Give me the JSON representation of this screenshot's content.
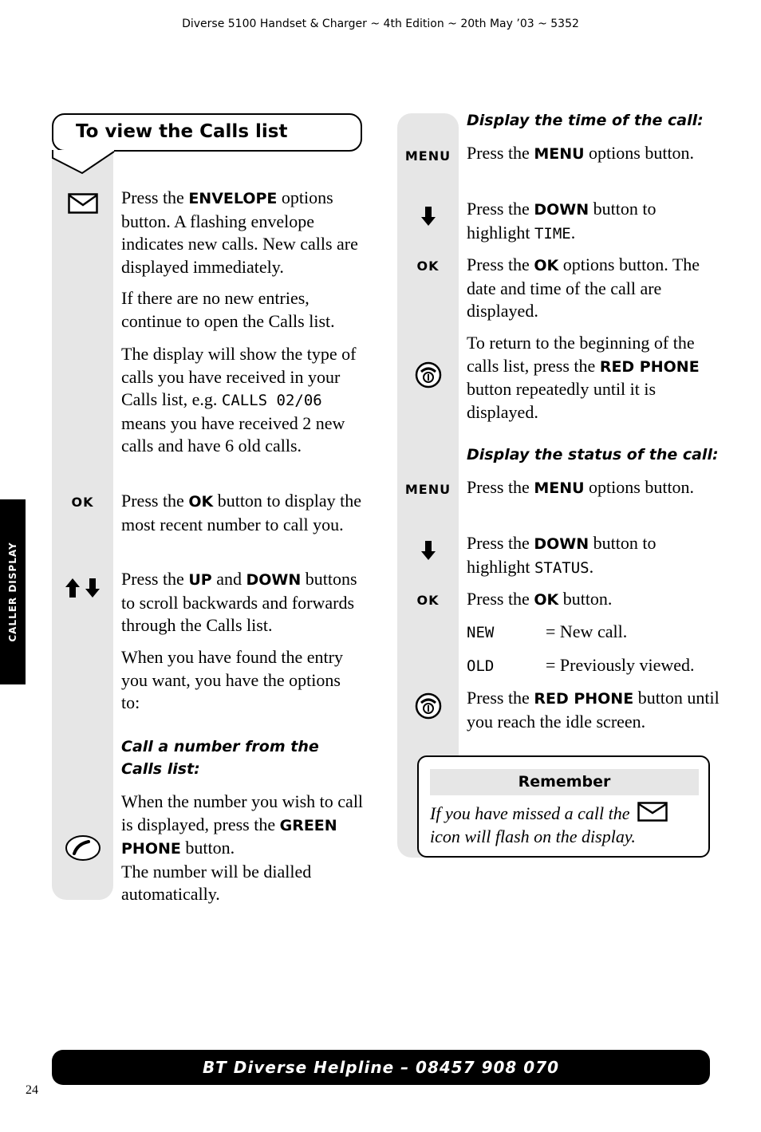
{
  "header": {
    "text": "Diverse 5100 Handset & Charger ~ 4th Edition ~ 20th May ’03 ~ 5352"
  },
  "side_tab": {
    "label": "CALLER DISPLAY"
  },
  "left": {
    "title": "To view the Calls list",
    "steps": [
      {
        "icon": "envelope-icon",
        "parts": [
          "Press the ",
          "ENVELOPE",
          " options button. A flashing envelope indicates new calls. New calls are displayed immediately."
        ]
      },
      {
        "text": "If there are no new entries, continue to open the Calls list."
      },
      {
        "parts": [
          "The display will show the type of calls you have received in your Calls list, e.g. ",
          "CALLS 02/06",
          " means you have received 2 new calls and have 6 old calls."
        ]
      },
      {
        "icon_label": "OK",
        "parts": [
          "Press the ",
          "OK",
          " button to display the most recent number to call you."
        ]
      },
      {
        "icon": "up-down-arrows-icon",
        "parts": [
          "Press the ",
          "UP",
          " and ",
          "DOWN",
          " buttons to scroll backwards and forwards through the Calls list."
        ]
      },
      {
        "text": "When you have found the entry you want, you have the options to:"
      }
    ],
    "subhead": "Call a number from the Calls list:",
    "call_step": {
      "icon": "green-phone-icon",
      "parts": [
        "When the number you wish to call is displayed, press the ",
        "GREEN PHONE",
        " button.",
        "The number will be dialled automatically."
      ]
    }
  },
  "right": {
    "time_subhead": "Display the time of the call:",
    "time_steps": [
      {
        "icon_label": "MENU",
        "parts": [
          "Press the ",
          "MENU",
          " options button."
        ]
      },
      {
        "icon": "down-arrow-icon",
        "parts": [
          "Press the ",
          "DOWN",
          " button to highlight ",
          "TIME",
          "."
        ]
      },
      {
        "icon_label": "OK",
        "parts": [
          "Press the ",
          "OK",
          " options button. The date and time of the call are displayed."
        ]
      },
      {
        "icon": "red-phone-icon",
        "parts": [
          "To return to the beginning of the calls list, press the ",
          "RED PHONE",
          " button repeatedly until it is displayed."
        ]
      }
    ],
    "status_subhead": "Display the status of the call:",
    "status_steps": [
      {
        "icon_label": "MENU",
        "parts": [
          "Press the ",
          "MENU",
          " options button."
        ]
      },
      {
        "icon": "down-arrow-icon",
        "parts": [
          "Press the ",
          "DOWN",
          " button to highlight ",
          "STATUS",
          "."
        ]
      },
      {
        "icon_label": "OK",
        "parts": [
          "Press the ",
          "OK",
          " button."
        ]
      },
      {
        "code": "NEW",
        "meaning": "= New call."
      },
      {
        "code": "OLD",
        "meaning": "= Previously viewed."
      },
      {
        "icon": "red-phone-icon",
        "parts": [
          "Press the ",
          "RED PHONE",
          " button until you reach the idle screen."
        ]
      }
    ]
  },
  "remember": {
    "heading": "Remember",
    "body_before": "If you have missed a call the",
    "body_after": "icon will flash on the display."
  },
  "footer": {
    "helpline": "BT Diverse Helpline – 08457 908 070"
  },
  "page_number": "24"
}
